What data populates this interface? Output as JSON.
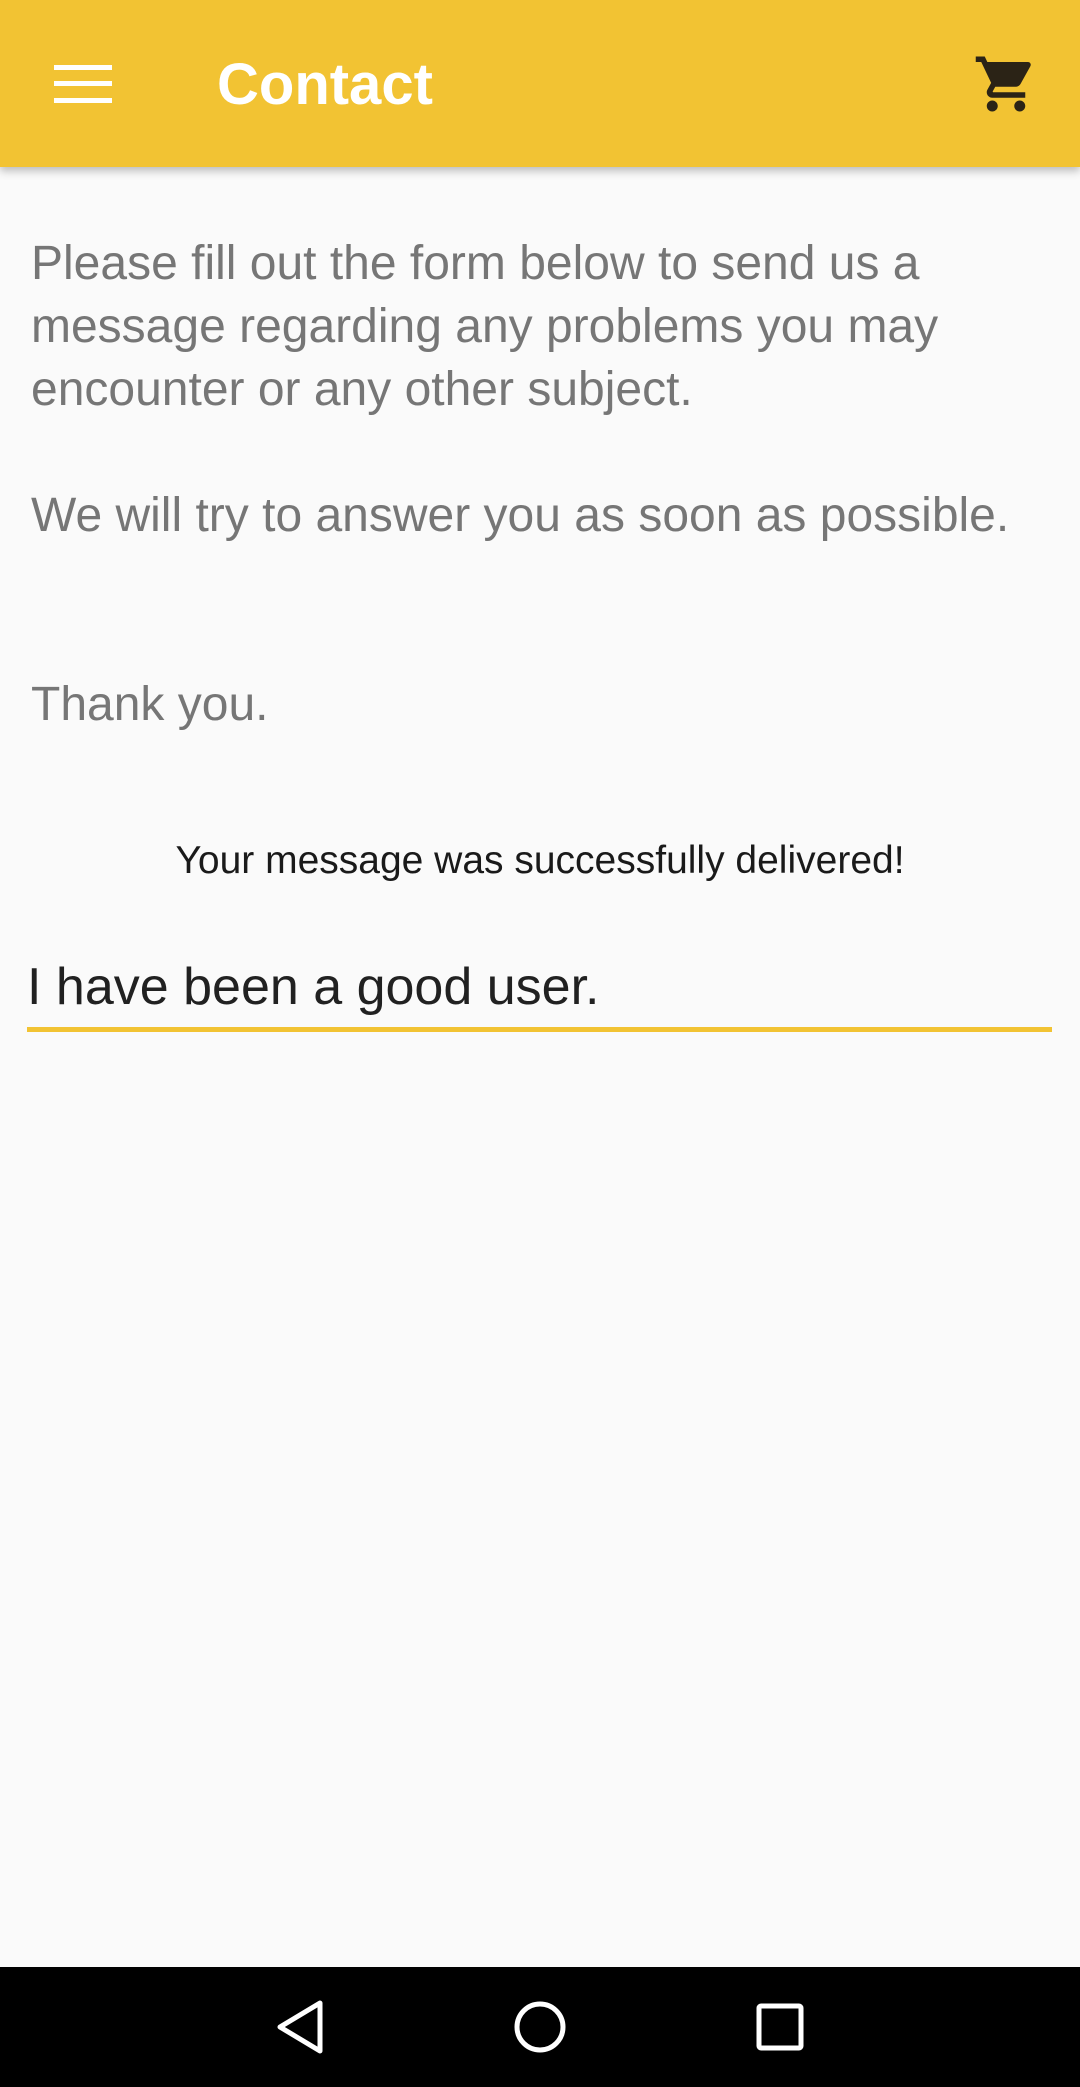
{
  "app_bar": {
    "title": "Contact",
    "background_color": "#f2c333",
    "menu_icon": "hamburger-menu-icon",
    "cart_icon": "shopping-cart-icon"
  },
  "intro": {
    "paragraph_1": "Please fill out the form below to send us a message regarding any problems you may encounter or any other subject.",
    "paragraph_2": "We will try to answer you as soon as possible.",
    "paragraph_3": "Thank you."
  },
  "status": {
    "message": "Your message was successfully delivered!"
  },
  "message_field": {
    "value": "I have been a good user.",
    "underline_color": "#f2c333"
  },
  "nav_bar": {
    "back_icon": "back-triangle-icon",
    "home_icon": "home-circle-icon",
    "recents_icon": "recents-square-icon"
  }
}
